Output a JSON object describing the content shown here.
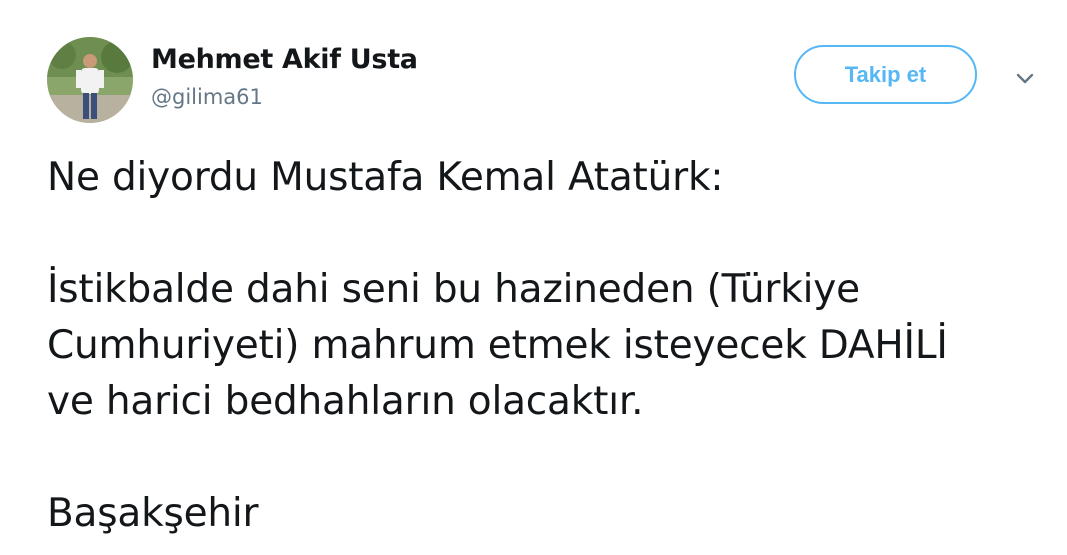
{
  "author": {
    "display_name": "Mehmet Akif Usta",
    "handle": "@gilima61"
  },
  "follow_button": {
    "label": "Takip et"
  },
  "menu": {
    "icon": "chevron-down-icon"
  },
  "colors": {
    "accent": "#1da1f2",
    "text": "#14171a",
    "secondary_text": "#657786"
  },
  "tweet": {
    "lines": [
      "Ne diyordu Mustafa Kemal Atatürk:",
      "İstikbalde dahi seni bu hazineden (Türkiye",
      "Cumhuriyeti) mahrum etmek isteyecek DAHİLİ",
      "ve harici bedhahların olacaktır.",
      "Başakşehir"
    ]
  }
}
